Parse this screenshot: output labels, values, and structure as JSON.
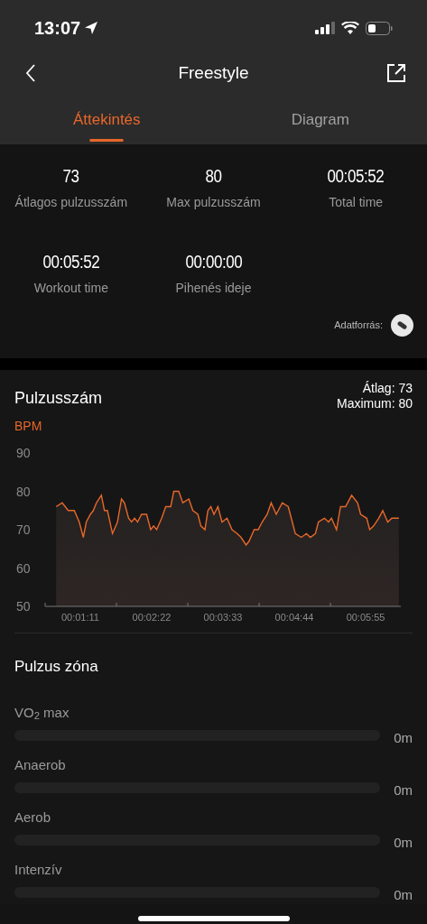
{
  "status_bar": {
    "time": "13:07"
  },
  "header": {
    "title": "Freestyle"
  },
  "tabs": [
    {
      "label": "Áttekintés",
      "selected": true
    },
    {
      "label": "Diagram",
      "selected": false
    }
  ],
  "stats": [
    {
      "value": "73",
      "label": "Átlagos pulzusszám"
    },
    {
      "value": "80",
      "label": "Max pulzusszám"
    },
    {
      "value": "00:05:52",
      "label": "Total time"
    },
    {
      "value": "00:05:52",
      "label": "Workout time"
    },
    {
      "value": "00:00:00",
      "label": "Pihenés ideje"
    }
  ],
  "data_source": {
    "label": "Adatforrás:"
  },
  "heart_rate": {
    "title": "Pulzusszám",
    "average": "Átlag: 73",
    "maximum": "Maximum: 80",
    "chart_data": {
      "type": "area",
      "xlim": [
        36,
        390
      ],
      "ylim": [
        50,
        90
      ],
      "yticks": [
        50,
        60,
        70,
        80,
        90
      ],
      "xticks": [
        {
          "value": 71,
          "label": "00:01:11"
        },
        {
          "value": 142,
          "label": "00:02:22"
        },
        {
          "value": 213,
          "label": "00:03:33"
        },
        {
          "value": 284,
          "label": "00:04:44"
        },
        {
          "value": 355,
          "label": "00:05:55"
        }
      ],
      "x": [
        47,
        53,
        59,
        65,
        70,
        74,
        77,
        81,
        84,
        87,
        92,
        95,
        98,
        103,
        108,
        112,
        115,
        119,
        122,
        125,
        128,
        132,
        137,
        141,
        144,
        147,
        152,
        156,
        161,
        164,
        169,
        173,
        179,
        183,
        188,
        191,
        195,
        198,
        201,
        204,
        208,
        212,
        217,
        222,
        227,
        231,
        236,
        239,
        244,
        248,
        252,
        257,
        261,
        266,
        272,
        278,
        282,
        285,
        291,
        296,
        300,
        305,
        308,
        314,
        318,
        321,
        326,
        330,
        335,
        341,
        347,
        350,
        356,
        359,
        363,
        368,
        372,
        377,
        381,
        388
      ],
      "series": [
        {
          "name": "BPM",
          "color": "#e8672a",
          "values": [
            76,
            77,
            75,
            75,
            72,
            68,
            72,
            74,
            75,
            77,
            79,
            75,
            75,
            69,
            72,
            78,
            77,
            73,
            72,
            73,
            72,
            74,
            74,
            70,
            71,
            70,
            73,
            76,
            76,
            80,
            80,
            77,
            78,
            75,
            74,
            71,
            70,
            75,
            76,
            74,
            76,
            72,
            73,
            70,
            69,
            68,
            66,
            67,
            70,
            70,
            72,
            74,
            77,
            74,
            77,
            76,
            72,
            69,
            68,
            69,
            68,
            69,
            72,
            73,
            72,
            73,
            70,
            76,
            76,
            79,
            77,
            74,
            73,
            70,
            71,
            73,
            75,
            72,
            73,
            73
          ]
        }
      ]
    }
  },
  "zones": {
    "title": "Pulzus zóna",
    "items": [
      {
        "label": "VO$_{2}$ max",
        "level": 0,
        "value": "0m"
      },
      {
        "label": "Anaerob",
        "level": 0,
        "value": "0m"
      },
      {
        "label": "Aerob",
        "level": 0,
        "value": "0m"
      },
      {
        "label": "Intenzív",
        "level": 0,
        "value": "0m"
      }
    ]
  }
}
